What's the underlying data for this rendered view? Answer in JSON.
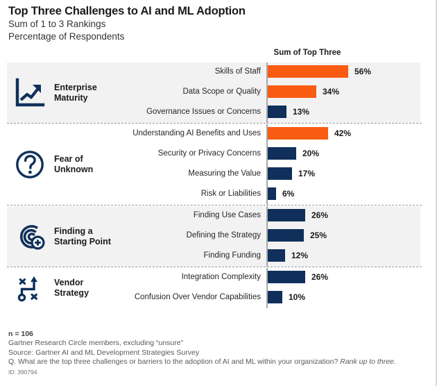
{
  "header": {
    "title": "Top Three Challenges to AI and ML Adoption",
    "subtitle1": "Sum of 1 to 3 Rankings",
    "subtitle2": "Percentage of Respondents"
  },
  "column_header": "Sum of Top Three",
  "colors": {
    "orange": "#F95B12",
    "navy": "#10305B",
    "band_shade": "#F2F2F2",
    "axis": "#A6A6A6",
    "separator": "#9A9A9A"
  },
  "groups": [
    {
      "label": "Enterprise\nMaturity",
      "icon": "growth-chart-icon",
      "shaded": true,
      "rows": [
        {
          "label": "Skills of Staff",
          "value": 56,
          "value_label": "56%",
          "color": "#F95B12"
        },
        {
          "label": "Data Scope or Quality",
          "value": 34,
          "value_label": "34%",
          "color": "#F95B12"
        },
        {
          "label": "Governance Issues or Concerns",
          "value": 13,
          "value_label": "13%",
          "color": "#10305B"
        }
      ]
    },
    {
      "label": "Fear of\nUnknown",
      "icon": "question-circle-icon",
      "shaded": false,
      "rows": [
        {
          "label": "Understanding AI Benefits and Uses",
          "value": 42,
          "value_label": "42%",
          "color": "#F95B12"
        },
        {
          "label": "Security or Privacy Concerns",
          "value": 20,
          "value_label": "20%",
          "color": "#10305B"
        },
        {
          "label": "Measuring the Value",
          "value": 17,
          "value_label": "17%",
          "color": "#10305B"
        },
        {
          "label": "Risk or Liabilities",
          "value": 6,
          "value_label": "6%",
          "color": "#10305B"
        }
      ]
    },
    {
      "label": "Finding a\nStarting Point",
      "icon": "target-plus-icon",
      "shaded": true,
      "rows": [
        {
          "label": "Finding Use Cases",
          "value": 26,
          "value_label": "26%",
          "color": "#10305B"
        },
        {
          "label": "Defining the Strategy",
          "value": 25,
          "value_label": "25%",
          "color": "#10305B"
        },
        {
          "label": "Finding Funding",
          "value": 12,
          "value_label": "12%",
          "color": "#10305B"
        }
      ]
    },
    {
      "label": "Vendor\nStrategy",
      "icon": "strategy-path-icon",
      "shaded": false,
      "rows": [
        {
          "label": "Integration Complexity",
          "value": 26,
          "value_label": "26%",
          "color": "#10305B"
        },
        {
          "label": "Confusion Over Vendor Capabilities",
          "value": 10,
          "value_label": "10%",
          "color": "#10305B"
        }
      ]
    }
  ],
  "footnotes": {
    "n": "n = 106",
    "line1": "Gartner Research Circle members, excluding “unsure”",
    "line2": "Source: Gartner AI and ML Development Strategies Survey",
    "question_pre": "Q. What are the top three challenges or barriers to the adoption of AI and ML within your organization? ",
    "question_ital": "Rank up to three.",
    "id": "ID: 390794"
  },
  "chart_data": {
    "type": "bar",
    "orientation": "horizontal",
    "title": "Top Three Challenges to AI and ML Adoption",
    "subtitle": "Sum of 1 to 3 Rankings / Percentage of Respondents",
    "xlabel": "Sum of Top Three",
    "ylabel": "",
    "xlim": [
      0,
      60
    ],
    "grid": false,
    "legend": "none",
    "value_suffix": "%",
    "categories": [
      "Skills of Staff",
      "Data Scope or Quality",
      "Governance Issues or Concerns",
      "Understanding AI Benefits and Uses",
      "Security or Privacy Concerns",
      "Measuring the Value",
      "Risk or Liabilities",
      "Finding Use Cases",
      "Defining the Strategy",
      "Finding Funding",
      "Integration Complexity",
      "Confusion Over Vendor Capabilities"
    ],
    "values": [
      56,
      34,
      13,
      42,
      20,
      17,
      6,
      26,
      25,
      12,
      26,
      10
    ],
    "group_of_category": [
      "Enterprise Maturity",
      "Enterprise Maturity",
      "Enterprise Maturity",
      "Fear of Unknown",
      "Fear of Unknown",
      "Fear of Unknown",
      "Fear of Unknown",
      "Finding a Starting Point",
      "Finding a Starting Point",
      "Finding a Starting Point",
      "Vendor Strategy",
      "Vendor Strategy"
    ],
    "bar_colors": [
      "#F95B12",
      "#F95B12",
      "#10305B",
      "#F95B12",
      "#10305B",
      "#10305B",
      "#10305B",
      "#10305B",
      "#10305B",
      "#10305B",
      "#10305B",
      "#10305B"
    ],
    "annotations": [
      "n = 106",
      "Gartner Research Circle members, excluding “unsure”",
      "Source: Gartner AI and ML Development Strategies Survey",
      "Q. What are the top three challenges or barriers to the adoption of AI and ML within your organization? Rank up to three.",
      "ID: 390794"
    ]
  }
}
